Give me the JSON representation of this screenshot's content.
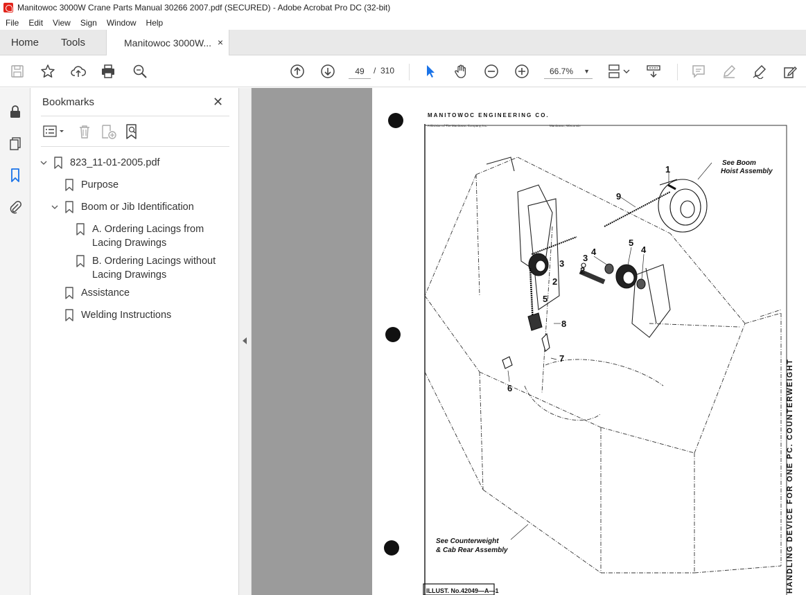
{
  "window": {
    "title": "Manitowoc 3000W Crane Parts Manual 30266 2007.pdf (SECURED) - Adobe Acrobat Pro DC (32-bit)"
  },
  "menu": [
    "File",
    "Edit",
    "View",
    "Sign",
    "Window",
    "Help"
  ],
  "tabs": {
    "home": "Home",
    "tools": "Tools",
    "document": "Manitowoc 3000W...",
    "close": "×"
  },
  "toolbar": {
    "page_current": "49",
    "page_sep": "/",
    "page_total": "310",
    "zoom": "66.7%"
  },
  "bookmarks": {
    "title": "Bookmarks",
    "close": "✕",
    "items": [
      {
        "label": "823_11-01-2005.pdf"
      },
      {
        "label": "Purpose"
      },
      {
        "label": "Boom or Jib Identification"
      },
      {
        "label": "A. Ordering Lacings from Lacing Drawings"
      },
      {
        "label": "B. Ordering Lacings without Lacing Drawings"
      },
      {
        "label": "Assistance"
      },
      {
        "label": "Welding Instructions"
      }
    ]
  },
  "document": {
    "header": "MANITOWOC ENGINEERING CO.",
    "subheader_left": "A Division of The Manitowoc Company, Inc.",
    "subheader_right": "Manitowoc, Wisconsin",
    "callout_boom": "See Boom",
    "callout_boom2": "Hoist Assembly",
    "callout_cw": "See Counterweight",
    "callout_cw2": "& Cab Rear Assembly",
    "side_title": "HANDLING DEVICE FOR ONE PC. COUNTERWEIGHT",
    "illust": "ILLUST. No.42049—A—1",
    "parts": {
      "p1": "1",
      "p9": "9",
      "p5a": "5",
      "p4a": "4",
      "p3a": "3",
      "p4b": "4",
      "p3b": "3",
      "p2a": "2",
      "p2b": "2",
      "p5b": "5",
      "p8": "8",
      "p7": "7",
      "p6": "6"
    }
  }
}
